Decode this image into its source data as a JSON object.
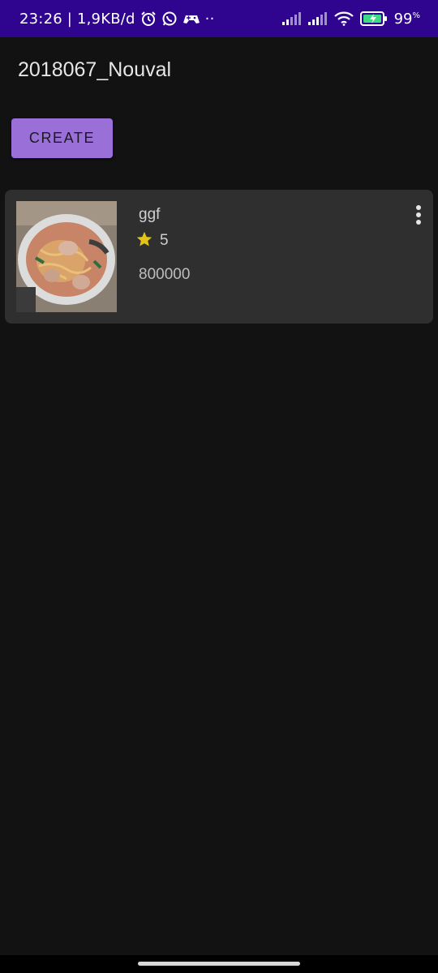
{
  "status_bar": {
    "time_and_speed": "23:26 | 1,9KB/d",
    "dots": "··",
    "battery_percent": "99",
    "battery_unit": "%",
    "icons": [
      "alarm-icon",
      "whatsapp-icon",
      "game-controller-icon",
      "signal-icon",
      "signal-icon",
      "wifi-icon",
      "battery-charging-icon"
    ],
    "background_color": "#2f058f"
  },
  "app": {
    "title": "2018067_Nouval",
    "create_button_label": "CREATE",
    "accent_color": "#9a6fd8"
  },
  "items": [
    {
      "name": "ggf",
      "rating": "5",
      "price": "800000",
      "image_icon": "food-photo",
      "star_color": "#e3c51a"
    }
  ]
}
